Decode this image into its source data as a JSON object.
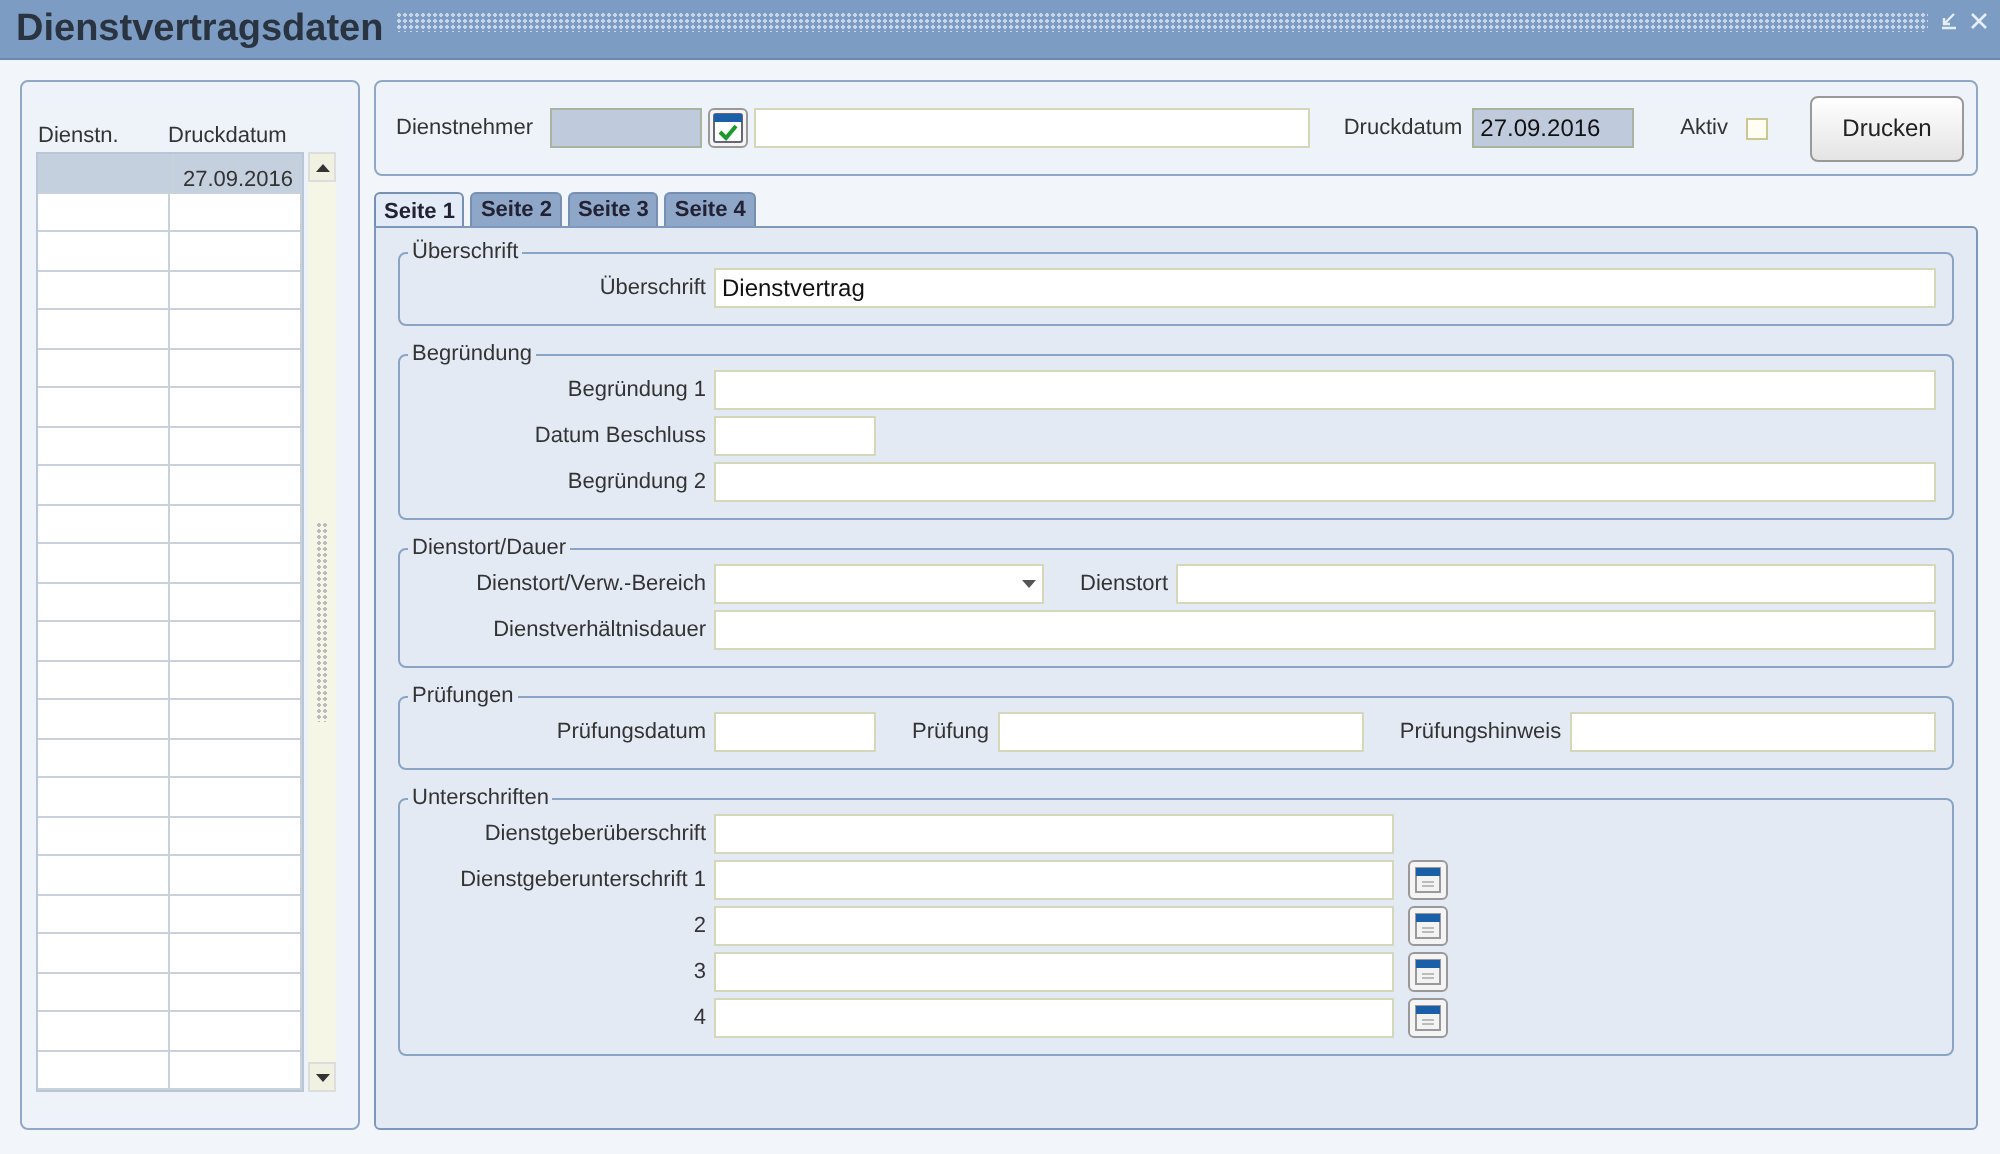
{
  "window": {
    "title": "Dienstvertragsdaten"
  },
  "list": {
    "columns": [
      "Dienstn.",
      "Druckdatum"
    ],
    "rows": [
      {
        "cells": [
          "",
          "27.09.2016"
        ],
        "selected": true
      }
    ]
  },
  "header": {
    "employee_label": "Dienstnehmer",
    "print_date_label": "Druckdatum",
    "print_date": "27.09.2016",
    "active_label": "Aktiv",
    "active": false,
    "print_button": "Drucken"
  },
  "tabs": [
    {
      "label": "Seite 1",
      "selected": true
    },
    {
      "label": "Seite 2",
      "selected": false
    },
    {
      "label": "Seite 3",
      "selected": false
    },
    {
      "label": "Seite 4",
      "selected": false
    }
  ],
  "sections": [
    {
      "title": "Überschrift",
      "rows": [
        [
          {
            "label": "Überschrift",
            "kind": "text",
            "value": "Dienstvertrag"
          }
        ]
      ]
    },
    {
      "title": "Begründung",
      "rows": [
        [
          {
            "label": "Begründung 1",
            "kind": "text"
          }
        ],
        [
          {
            "label": "Datum Beschluss",
            "kind": "date"
          }
        ],
        [
          {
            "label": "Begründung 2",
            "kind": "text"
          }
        ]
      ]
    },
    {
      "title": "Dienstort/Dauer",
      "rows": [
        [
          {
            "label": "Dienstort/Verw.-Bereich",
            "kind": "select"
          },
          {
            "label": "Dienstort",
            "kind": "text"
          }
        ],
        [
          {
            "label": "Dienstverhältnisdauer",
            "kind": "text"
          }
        ]
      ]
    },
    {
      "title": "Prüfungen",
      "rows": [
        [
          {
            "label": "Prüfungsdatum",
            "kind": "date"
          },
          {
            "label": "Prüfung",
            "kind": "text"
          },
          {
            "label": "Prüfungshinweis",
            "kind": "text"
          }
        ]
      ]
    },
    {
      "title": "Unterschriften",
      "rows": [
        [
          {
            "label": "Dienstgeberüberschrift",
            "kind": "line"
          }
        ],
        [
          {
            "label": "Dienstgeberunterschrift 1",
            "kind": "signature"
          }
        ],
        [
          {
            "label": "2",
            "kind": "signature"
          }
        ],
        [
          {
            "label": "3",
            "kind": "signature"
          }
        ],
        [
          {
            "label": "4",
            "kind": "signature"
          }
        ]
      ]
    }
  ]
}
